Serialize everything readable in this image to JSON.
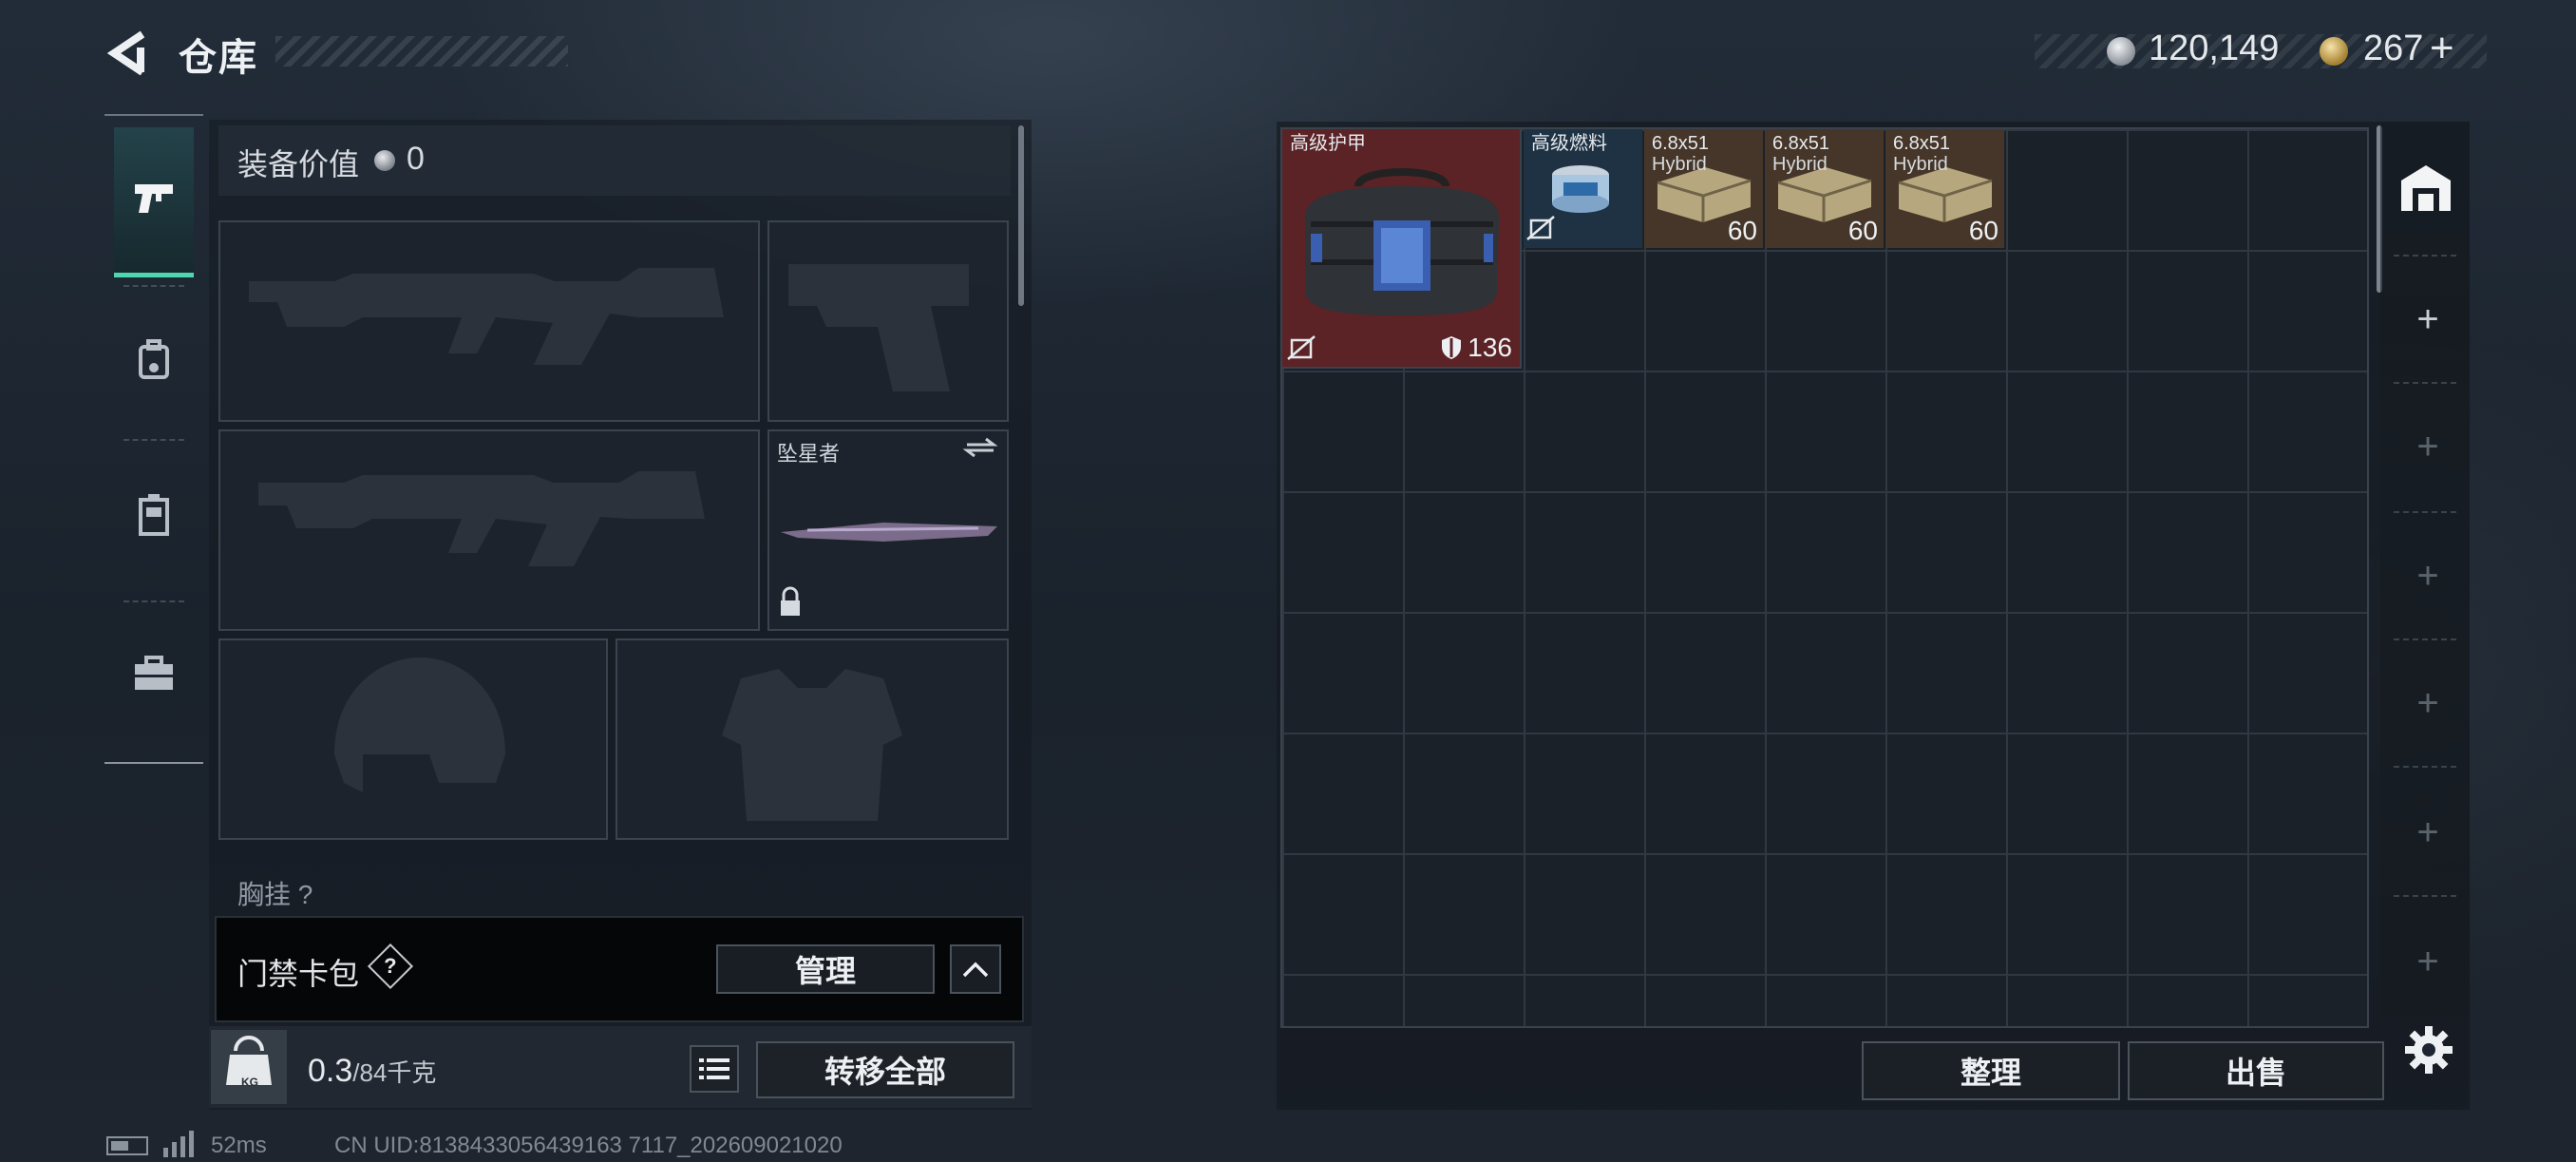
{
  "header": {
    "title": "仓库",
    "back_icon": "back-arrow-icon",
    "currency_silver": "120,149",
    "currency_gold": "267",
    "add_currency": "+"
  },
  "tabs": [
    {
      "name": "weapons",
      "icon": "pistol-icon",
      "active": true
    },
    {
      "name": "backpack",
      "icon": "backpack-icon",
      "active": false
    },
    {
      "name": "rig",
      "icon": "rig-icon",
      "active": false
    },
    {
      "name": "case",
      "icon": "briefcase-icon",
      "active": false
    }
  ],
  "equipment": {
    "value_label": "装备价值",
    "value": "0",
    "melee_name": "坠星者",
    "chest_label": "胸挂",
    "chest_help": "?"
  },
  "keycard": {
    "label": "门禁卡包",
    "help": "?",
    "manage_label": "管理"
  },
  "weight": {
    "icon_label": "KG",
    "current": "0.3",
    "max": "/84千克",
    "transfer_label": "转移全部"
  },
  "status": {
    "ping": "52ms",
    "uid": "CN UID:8138433056439163 7117_202609021020"
  },
  "storage": {
    "items": [
      {
        "name": "高级护甲",
        "durability": "136",
        "color": "#5b2326"
      },
      {
        "name": "高级燃料",
        "color": "#1e3244"
      },
      {
        "name": "6.8x51",
        "sub": "Hybrid",
        "count": "60",
        "color": "#463629"
      },
      {
        "name": "6.8x51",
        "sub": "Hybrid",
        "count": "60",
        "color": "#463629"
      },
      {
        "name": "6.8x51",
        "sub": "Hybrid",
        "count": "60",
        "color": "#463629"
      }
    ],
    "sort_label": "整理",
    "sell_label": "出售"
  },
  "colors": {
    "accent": "#4fd6b0",
    "rare_red": "#5b2326",
    "ammo_brown": "#463629",
    "fuel_blue": "#1e3244"
  }
}
